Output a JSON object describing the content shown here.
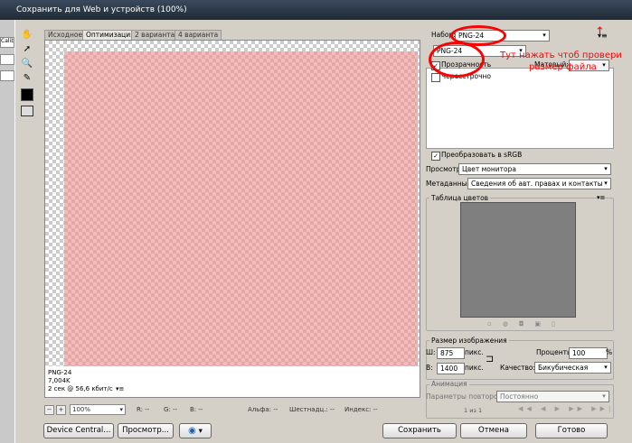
{
  "window": {
    "title": "Сохранить для Web и устройств (100%)"
  },
  "outer": {
    "frag1": "Calib"
  },
  "tabs": [
    "Исходное",
    "Оптимизация",
    "2 варианта",
    "4 варианта"
  ],
  "info": {
    "format": "PNG-24",
    "size": "7,004K",
    "speed": "2 сек @ 56,6 кбит/с"
  },
  "status": {
    "zoom": "100%",
    "r": "R: --",
    "g": "G: --",
    "b": "B: --",
    "alpha": "Альфа: --",
    "hex": "Шестнадц.: --",
    "index": "Индекс: --"
  },
  "buttons": {
    "device_central": "Device Central...",
    "preview": "Просмотр...",
    "save": "Сохранить",
    "cancel": "Отмена",
    "done": "Готово"
  },
  "settings": {
    "preset_label": "Набор:",
    "preset_value": "PNG-24",
    "format_value": "PNG-24",
    "transparency": "Прозрачность",
    "interlaced": "Чересстрочно",
    "matte_label": "Матовый:",
    "convert_srgb": "Преобразовать в sRGB",
    "preview_label": "Просмотр:",
    "preview_value": "Цвет монитора",
    "metadata_label": "Метаданные:",
    "metadata_value": "Сведения об авт. правах и контакты",
    "color_table": "Таблица цветов",
    "image_size": "Размер изображения",
    "w_label": "Ш:",
    "w_value": "875",
    "h_label": "В:",
    "h_value": "1400",
    "units": "пикс.",
    "percent_label": "Проценты:",
    "percent_value": "100",
    "percent_sign": "%",
    "quality_label": "Качество:",
    "quality_value": "Бикубическая",
    "animation": "Анимация",
    "loop_label": "Параметры повторов:",
    "loop_value": "Постоянно",
    "frame_counter": "1 из 1"
  },
  "annotation": {
    "line1": "Тут нажать чтоб провери",
    "line2": "размер файла",
    "arrow": "↑"
  },
  "colors": {
    "accent_red": "#ff0000",
    "swatch": "#7f7f7f",
    "pink": "#f2bcbc"
  }
}
